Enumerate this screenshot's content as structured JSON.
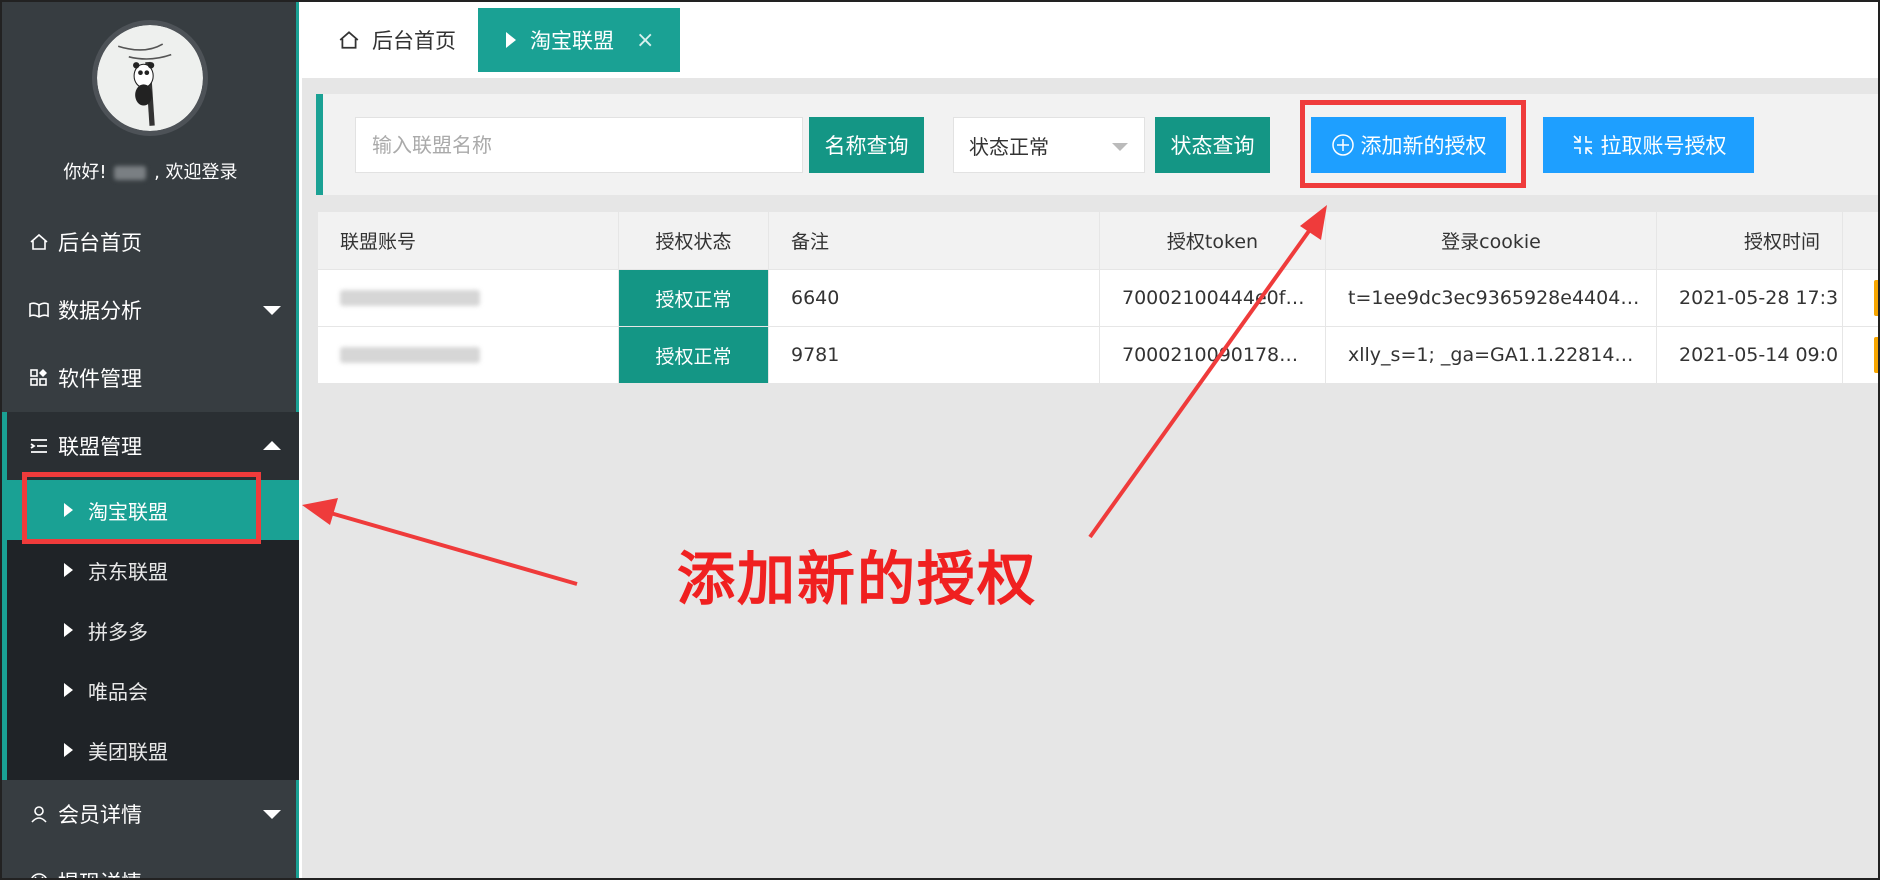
{
  "sidebar": {
    "welcome_prefix": "你好!",
    "welcome_suffix": ", 欢迎登录",
    "items": [
      {
        "label": "后台首页",
        "icon": "home-icon"
      },
      {
        "label": "数据分析",
        "icon": "book-icon"
      },
      {
        "label": "软件管理",
        "icon": "grid-icon"
      },
      {
        "label": "联盟管理",
        "icon": "list-icon"
      },
      {
        "label": "会员详情",
        "icon": "user-icon"
      },
      {
        "label": "提现详情",
        "icon": "yen-icon"
      }
    ],
    "sub_items": [
      {
        "label": "淘宝联盟"
      },
      {
        "label": "京东联盟"
      },
      {
        "label": "拼多多"
      },
      {
        "label": "唯品会"
      },
      {
        "label": "美团联盟"
      }
    ]
  },
  "tabs": {
    "home": "后台首页",
    "active": "淘宝联盟",
    "close": "×"
  },
  "toolbar": {
    "search_placeholder": "输入联盟名称",
    "name_query": "名称查询",
    "status_select": "状态正常",
    "status_query": "状态查询",
    "add_auth": "添加新的授权",
    "pull_auth": "拉取账号授权"
  },
  "table": {
    "headers": [
      "联盟账号",
      "授权状态",
      "备注",
      "授权token",
      "登录cookie",
      "授权时间"
    ],
    "rows": [
      {
        "status": "授权正常",
        "note": "6640",
        "token": "70002100444e0f…",
        "cookie": "t=1ee9dc3ec9365928e4404…",
        "time": "2021-05-28 17:3"
      },
      {
        "status": "授权正常",
        "note": "9781",
        "token": "7000210090178…",
        "cookie": "xlly_s=1; _ga=GA1.1.22814…",
        "time": "2021-05-14 09:0"
      }
    ]
  },
  "annotation": {
    "text": "添加新的授权",
    "color": "#f02020"
  },
  "colors": {
    "accent": "#1aa194",
    "button_teal": "#149685",
    "button_blue": "#1e9fff",
    "sidebar_bg": "#373d41",
    "highlight": "#ef3b3b"
  }
}
